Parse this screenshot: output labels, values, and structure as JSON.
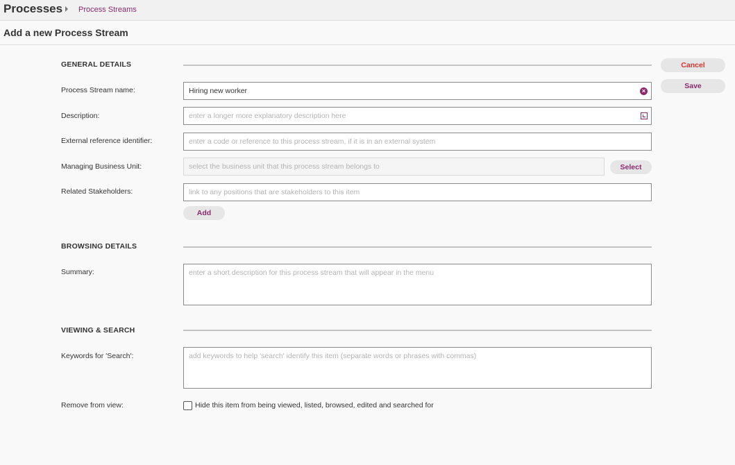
{
  "header": {
    "app_title": "Processes",
    "breadcrumb": "Process Streams"
  },
  "page": {
    "title": "Add a new Process Stream"
  },
  "actions": {
    "cancel_label": "Cancel",
    "save_label": "Save"
  },
  "sections": {
    "general": "GENERAL DETAILS",
    "browsing": "BROWSING DETAILS",
    "viewing": "VIEWING & SEARCH"
  },
  "fields": {
    "name": {
      "label": "Process Stream name:",
      "value": "Hiring new worker"
    },
    "description": {
      "label": "Description:",
      "placeholder": "enter a longer more explanatory description here"
    },
    "external_ref": {
      "label": "External reference identifier:",
      "placeholder": "enter a code or reference to this process stream, if it is in an external system"
    },
    "business_unit": {
      "label": "Managing Business Unit:",
      "placeholder": "select the business unit that this process stream belongs to",
      "button": "Select"
    },
    "stakeholders": {
      "label": "Related Stakeholders:",
      "placeholder": "link to any positions that are stakeholders to this item",
      "button": "Add"
    },
    "summary": {
      "label": "Summary:",
      "placeholder": "enter a short description for this process stream that will appear in the menu"
    },
    "keywords": {
      "label": "Keywords for 'Search':",
      "placeholder": "add keywords to help 'search' identify this item (separate words or phrases with commas)"
    },
    "remove": {
      "label": "Remove from view:",
      "checkbox_label": "Hide this item from being viewed, listed, browsed, edited and searched for",
      "checked": false
    }
  },
  "icons": {
    "clear": "clear-icon",
    "expand": "expand-icon",
    "breadcrumb_separator": "chevron-right-icon"
  },
  "colors": {
    "accent": "#8a2a6e",
    "cancel": "#d9342b"
  }
}
